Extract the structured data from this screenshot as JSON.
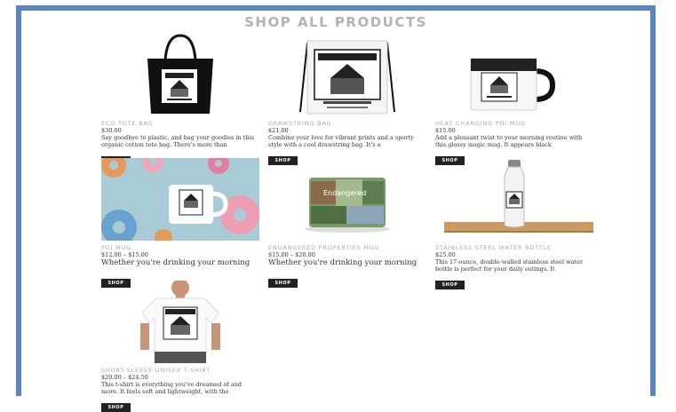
{
  "page": {
    "title": "SHOP ALL PRODUCTS"
  },
  "products": [
    {
      "name": "ECO TOTE BAG",
      "price": "$30.00",
      "description": "Say goodbye to plastic, and bag your goodies in this organic cotton tote bag. There's more than",
      "button": "SHOP",
      "icon": "tote-bag-image"
    },
    {
      "name": "DRAWSTRING BAG",
      "price": "$21.00",
      "description": "Combine your love for vibrant prints and a sporty style with a cool drawstring bag. It's a",
      "button": "SHOP",
      "icon": "drawstring-bag-image"
    },
    {
      "name": "HEAT CHANGING PDI MUG",
      "price": "$15.00",
      "description": "Add a pleasant twist to your morning routine with this glossy magic mug. It appears black",
      "button": "SHOP",
      "icon": "magic-mug-image"
    },
    {
      "name": "PDI MUG",
      "price": "$12.00 – $15.00",
      "description": "Whether you're drinking your morning",
      "button": "SHOP",
      "icon": "donut-mug-image"
    },
    {
      "name": "ENDANGERED PROPERTIES MUG",
      "price": "$15.00 – $20.00",
      "description": "Whether you're drinking your morning",
      "button": "SHOP",
      "icon": "properties-mug-image"
    },
    {
      "name": "STAINLESS STEEL WATER BOTTLE",
      "price": "$25.00",
      "description": "This 17-ounce, double-walled stainless steel water bottle is perfect for your daily outings. It",
      "button": "SHOP",
      "icon": "water-bottle-image"
    },
    {
      "name": "SHORT-SLEEVE UNISEX T-SHIRT",
      "price": "$20.00 – $24.50",
      "description": "This t-shirt is everything you've dreamed of and more. It feels soft and lightweight, with the",
      "button": "SHOP",
      "icon": "tshirt-image"
    }
  ],
  "mug_art_text": "Endangered"
}
